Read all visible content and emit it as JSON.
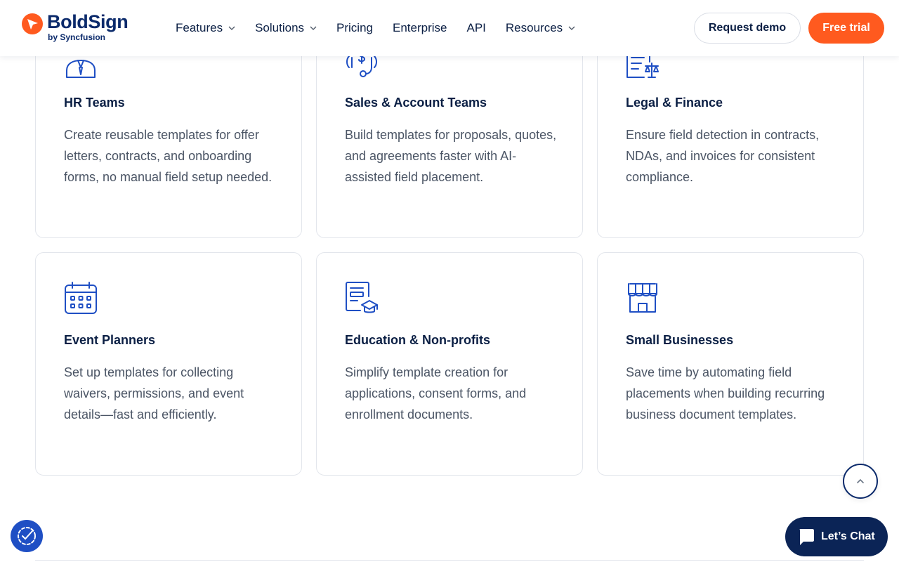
{
  "brand": {
    "name": "BoldSign",
    "tagline": "by Syncfusion",
    "logo_color": "#ff5a1f",
    "text_color": "#0b2a6b"
  },
  "nav": {
    "items": [
      {
        "label": "Features",
        "has_dropdown": true
      },
      {
        "label": "Solutions",
        "has_dropdown": true
      },
      {
        "label": "Pricing",
        "has_dropdown": false
      },
      {
        "label": "Enterprise",
        "has_dropdown": false
      },
      {
        "label": "API",
        "has_dropdown": false
      },
      {
        "label": "Resources",
        "has_dropdown": true
      }
    ],
    "request_demo_label": "Request demo",
    "free_trial_label": "Free trial",
    "accent_color": "#ff5a1f"
  },
  "cards": [
    {
      "icon": "hr-person-icon",
      "title": "HR Teams",
      "description": "Create reusable templates for offer letters, contracts, and onboarding forms, no manual field setup needed."
    },
    {
      "icon": "dollar-handshake-icon",
      "title": "Sales & Account Teams",
      "description": "Build templates for proposals, quotes, and agreements faster with AI-assisted field placement."
    },
    {
      "icon": "document-scale-icon",
      "title": "Legal & Finance",
      "description": "Ensure field detection in contracts, NDAs, and invoices for consistent compliance."
    },
    {
      "icon": "calendar-icon",
      "title": "Event Planners",
      "description": "Set up templates for collecting waivers, permissions, and event details—fast and efficiently."
    },
    {
      "icon": "document-graduation-cap-icon",
      "title": "Education & Non-profits",
      "description": "Simplify template creation for applications, consent forms, and enrollment documents."
    },
    {
      "icon": "storefront-icon",
      "title": "Small Businesses",
      "description": "Save time by automating field placements when building recurring business document templates."
    }
  ],
  "icon_color": "#1f4fc4",
  "chat": {
    "label": "Let’s Chat",
    "background": "#0b2456"
  },
  "scroll_top": {
    "icon": "chevron-up-icon"
  },
  "accessibility": {
    "icon": "accessibility-icon",
    "background": "#1f4fc4"
  }
}
